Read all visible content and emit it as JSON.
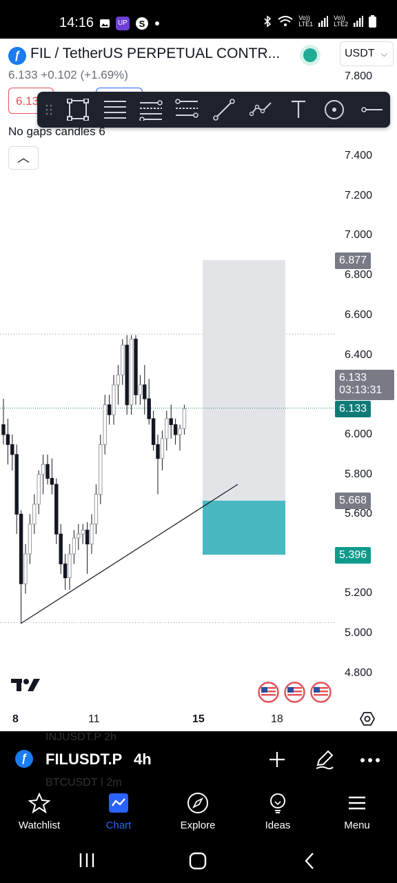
{
  "status_bar": {
    "time": "14:16",
    "lte1": "Vo))\nLTE1",
    "lte2": "Vo))\nLTE2"
  },
  "header": {
    "title": "FIL / TetherUS PERPETUAL CONTR...",
    "currency": "USDT",
    "last_price": "6.133",
    "change": "+0.102 (+1.69%)",
    "sell_price": "6.13",
    "indicator_label": "No gaps candles 6"
  },
  "toolbar": {
    "tools": [
      "rectangle-icon",
      "horizontal-lines-icon",
      "fib-channel-icon",
      "pitchfork-icon",
      "trend-line-icon",
      "path-icon",
      "text-icon",
      "circle-dot-icon",
      "horizontal-ray-icon"
    ]
  },
  "price_axis": {
    "ticks": [
      "7.800",
      "7.400",
      "7.200",
      "7.000",
      "6.800",
      "6.600",
      "6.400",
      "6.000",
      "5.800",
      "5.600",
      "5.200",
      "5.000",
      "4.800"
    ]
  },
  "price_tags": {
    "target": "6.877",
    "current": "6.133",
    "countdown": "03:13:31",
    "current_line": "6.133",
    "entry": "5.668",
    "stop": "5.396"
  },
  "time_axis": {
    "labels": [
      "8",
      "11",
      "15",
      "18"
    ]
  },
  "symbol_bar": {
    "ghost_top": "INJUSDT.P  2h",
    "symbol": "FILUSDT.P",
    "interval": "4h",
    "ghost_bottom": "BTCUSDT  |  2m"
  },
  "bottom_nav": {
    "items": [
      {
        "label": "Watchlist",
        "icon": "star-icon"
      },
      {
        "label": "Chart",
        "icon": "chart-icon"
      },
      {
        "label": "Explore",
        "icon": "compass-icon"
      },
      {
        "label": "Ideas",
        "icon": "lightbulb-icon"
      },
      {
        "label": "Menu",
        "icon": "menu-icon"
      }
    ]
  },
  "colors": {
    "up": "#ffffff",
    "down": "#000000",
    "accent": "#2962ff",
    "teal": "#22ab94",
    "stop_zone": "#48b9c2",
    "target_zone": "#e3e4e8"
  },
  "chart_data": {
    "type": "candlestick",
    "ylim": [
      4.7,
      7.9
    ],
    "candles": [
      {
        "o": 6.05,
        "h": 6.18,
        "l": 5.95,
        "c": 6.0
      },
      {
        "o": 6.0,
        "h": 6.08,
        "l": 5.85,
        "c": 5.95
      },
      {
        "o": 5.95,
        "h": 6.0,
        "l": 5.82,
        "c": 5.9
      },
      {
        "o": 5.9,
        "h": 5.95,
        "l": 5.5,
        "c": 5.6
      },
      {
        "o": 5.6,
        "h": 5.62,
        "l": 5.05,
        "c": 5.25
      },
      {
        "o": 5.25,
        "h": 5.45,
        "l": 5.2,
        "c": 5.4
      },
      {
        "o": 5.4,
        "h": 5.6,
        "l": 5.35,
        "c": 5.55
      },
      {
        "o": 5.55,
        "h": 5.7,
        "l": 5.5,
        "c": 5.65
      },
      {
        "o": 5.65,
        "h": 5.82,
        "l": 5.6,
        "c": 5.8
      },
      {
        "o": 5.8,
        "h": 5.9,
        "l": 5.7,
        "c": 5.85
      },
      {
        "o": 5.85,
        "h": 5.9,
        "l": 5.75,
        "c": 5.78
      },
      {
        "o": 5.78,
        "h": 5.88,
        "l": 5.7,
        "c": 5.75
      },
      {
        "o": 5.75,
        "h": 5.78,
        "l": 5.45,
        "c": 5.5
      },
      {
        "o": 5.5,
        "h": 5.55,
        "l": 5.3,
        "c": 5.35
      },
      {
        "o": 5.35,
        "h": 5.4,
        "l": 5.22,
        "c": 5.28
      },
      {
        "o": 5.28,
        "h": 5.45,
        "l": 5.22,
        "c": 5.4
      },
      {
        "o": 5.4,
        "h": 5.52,
        "l": 5.35,
        "c": 5.48
      },
      {
        "o": 5.48,
        "h": 5.55,
        "l": 5.42,
        "c": 5.5
      },
      {
        "o": 5.5,
        "h": 5.55,
        "l": 5.45,
        "c": 5.52
      },
      {
        "o": 5.52,
        "h": 5.56,
        "l": 5.3,
        "c": 5.45
      },
      {
        "o": 5.45,
        "h": 5.6,
        "l": 5.4,
        "c": 5.55
      },
      {
        "o": 5.55,
        "h": 5.75,
        "l": 5.5,
        "c": 5.7
      },
      {
        "o": 5.7,
        "h": 6.0,
        "l": 5.65,
        "c": 5.95
      },
      {
        "o": 5.95,
        "h": 6.2,
        "l": 5.9,
        "c": 6.15
      },
      {
        "o": 6.15,
        "h": 6.2,
        "l": 6.05,
        "c": 6.1
      },
      {
        "o": 6.1,
        "h": 6.3,
        "l": 6.05,
        "c": 6.25
      },
      {
        "o": 6.25,
        "h": 6.35,
        "l": 6.15,
        "c": 6.3
      },
      {
        "o": 6.3,
        "h": 6.48,
        "l": 6.25,
        "c": 6.45
      },
      {
        "o": 6.45,
        "h": 6.5,
        "l": 6.1,
        "c": 6.15
      },
      {
        "o": 6.15,
        "h": 6.5,
        "l": 6.1,
        "c": 6.48
      },
      {
        "o": 6.48,
        "h": 6.5,
        "l": 6.15,
        "c": 6.2
      },
      {
        "o": 6.2,
        "h": 6.3,
        "l": 6.15,
        "c": 6.25
      },
      {
        "o": 6.25,
        "h": 6.35,
        "l": 6.1,
        "c": 6.18
      },
      {
        "o": 6.18,
        "h": 6.28,
        "l": 6.05,
        "c": 6.08
      },
      {
        "o": 6.08,
        "h": 6.12,
        "l": 5.92,
        "c": 5.95
      },
      {
        "o": 5.95,
        "h": 6.0,
        "l": 5.7,
        "c": 5.88
      },
      {
        "o": 5.88,
        "h": 6.02,
        "l": 5.82,
        "c": 5.98
      },
      {
        "o": 5.98,
        "h": 6.12,
        "l": 5.92,
        "c": 6.08
      },
      {
        "o": 6.08,
        "h": 6.15,
        "l": 5.98,
        "c": 6.05
      },
      {
        "o": 6.05,
        "h": 6.08,
        "l": 5.95,
        "c": 6.0
      },
      {
        "o": 6.0,
        "h": 6.05,
        "l": 5.92,
        "c": 6.03
      },
      {
        "o": 6.03,
        "h": 6.15,
        "l": 6.0,
        "c": 6.13
      }
    ],
    "trendline": {
      "from": 5.05,
      "to": 5.75
    },
    "target_price": 6.877,
    "entry_price": 5.668,
    "stop_price": 5.396,
    "high_line": 6.505,
    "low_line": 5.055
  }
}
